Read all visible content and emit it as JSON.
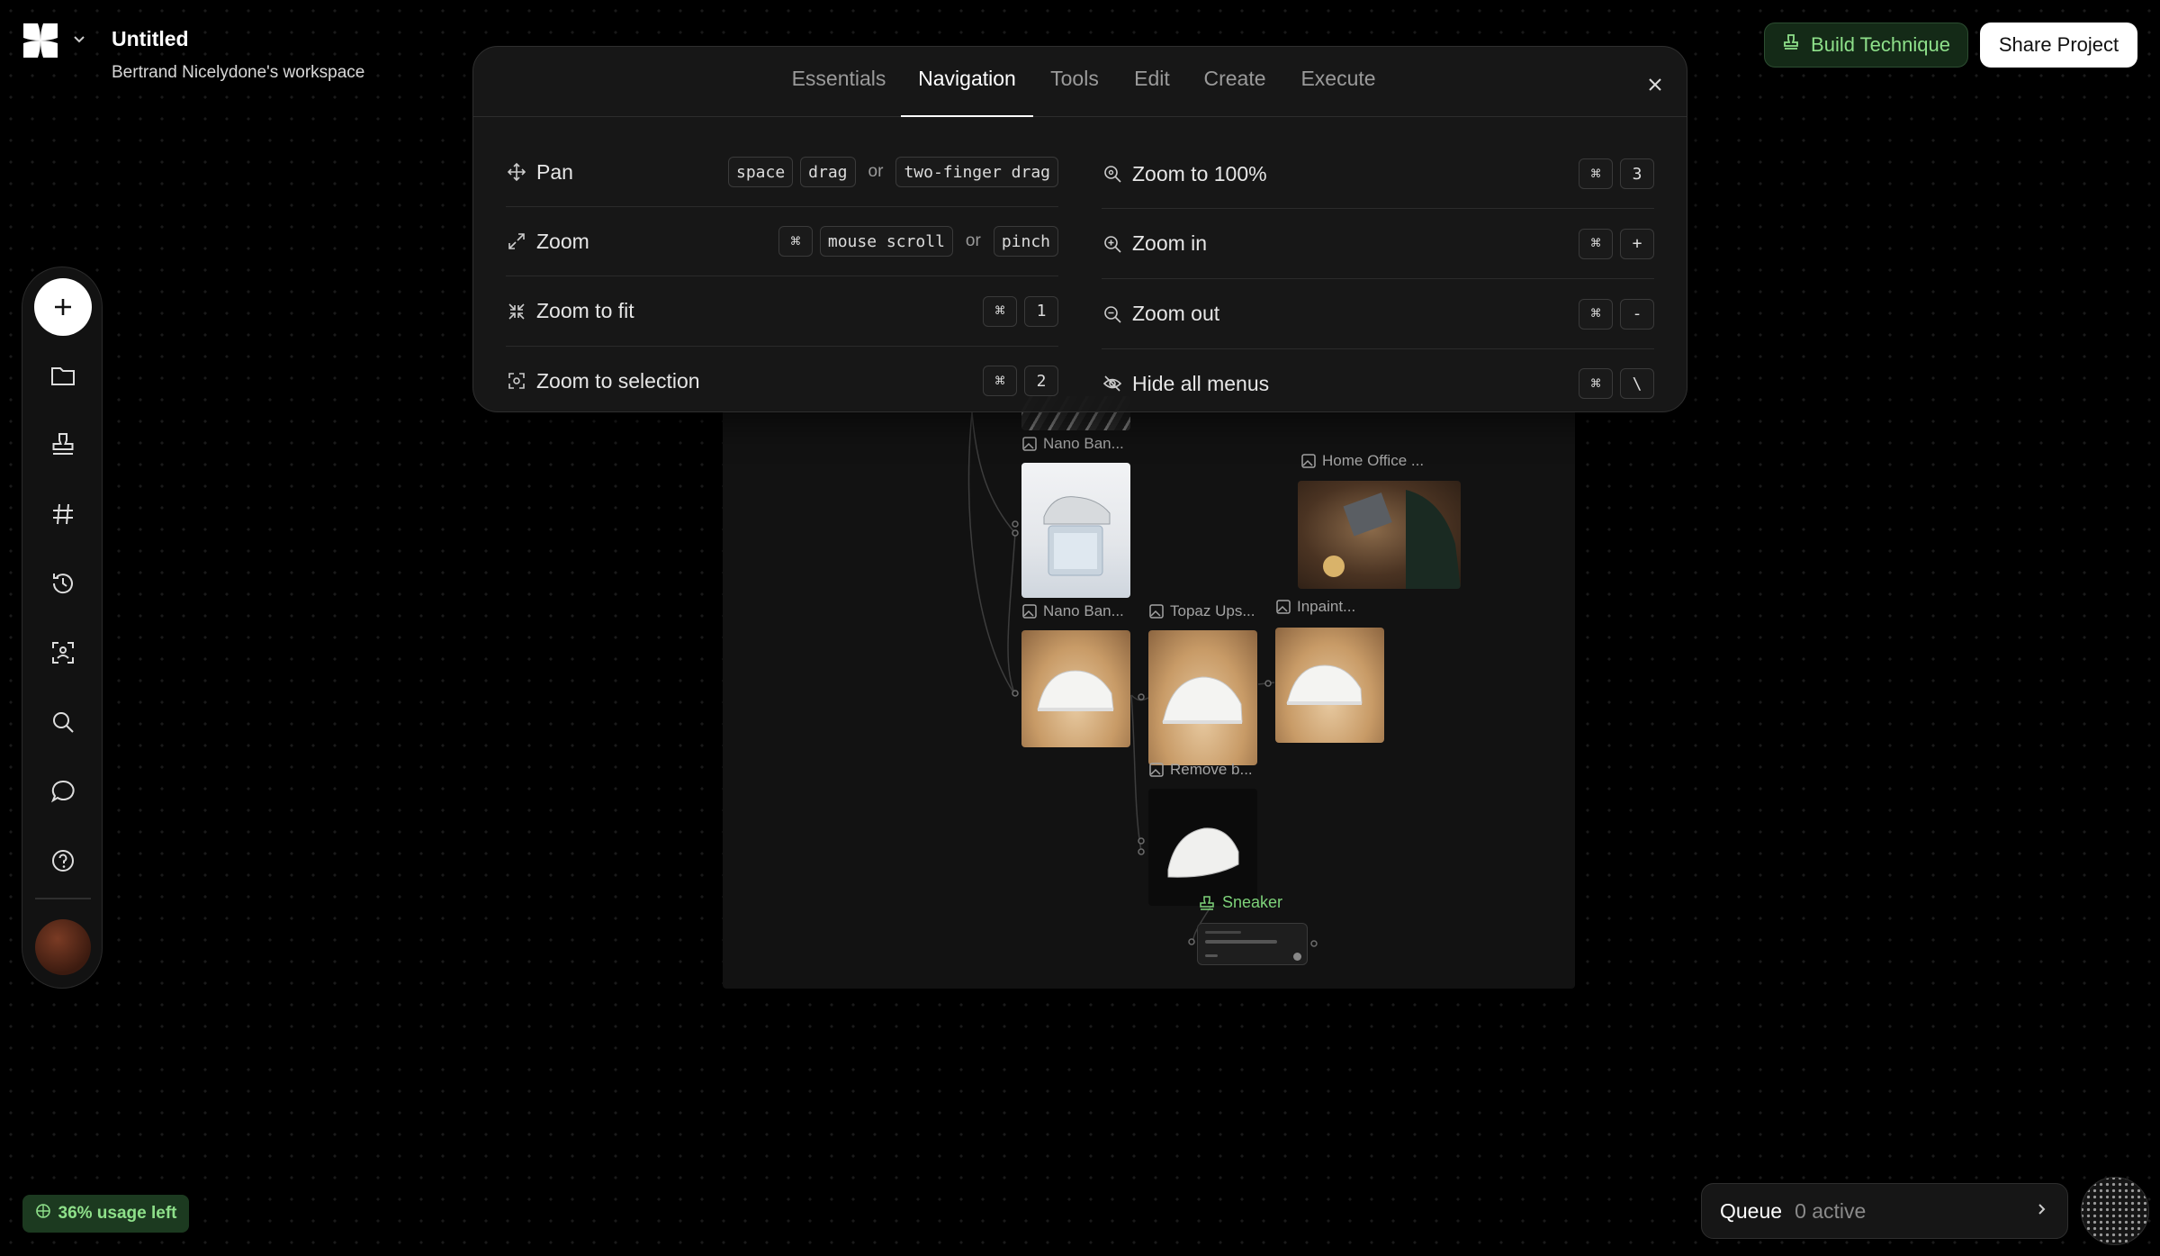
{
  "header": {
    "project_title": "Untitled",
    "workspace": "Bertrand Nicelydone's workspace",
    "build_button": "Build Technique",
    "share_button": "Share Project"
  },
  "toolbar": {
    "icons": [
      "plus-icon",
      "folder-icon",
      "stamp-icon",
      "hash-icon",
      "history-icon",
      "focus-icon",
      "search-icon",
      "chat-icon",
      "help-icon"
    ]
  },
  "panel": {
    "tabs": [
      "Essentials",
      "Navigation",
      "Tools",
      "Edit",
      "Create",
      "Execute"
    ],
    "active_tab": "Navigation",
    "left_rows": [
      {
        "label": "Pan",
        "keys": [
          "space",
          "drag"
        ],
        "or": "or",
        "alt_keys": [
          "two-finger drag"
        ]
      },
      {
        "label": "Zoom",
        "keys": [
          "⌘",
          "mouse scroll"
        ],
        "or": "or",
        "alt_keys": [
          "pinch"
        ]
      },
      {
        "label": "Zoom to fit",
        "keys": [
          "⌘",
          "1"
        ]
      },
      {
        "label": "Zoom to selection",
        "keys": [
          "⌘",
          "2"
        ]
      }
    ],
    "right_rows": [
      {
        "label": "Zoom to 100%",
        "keys": [
          "⌘",
          "3"
        ]
      },
      {
        "label": "Zoom in",
        "keys": [
          "⌘",
          "+"
        ]
      },
      {
        "label": "Zoom out",
        "keys": [
          "⌘",
          "-"
        ]
      },
      {
        "label": "Hide all menus",
        "keys": [
          "⌘",
          "\\"
        ]
      }
    ]
  },
  "canvas": {
    "nodes": {
      "nano1": "Nano Ban...",
      "nano2": "Nano Ban...",
      "home_office": "Home Office ...",
      "topaz": "Topaz Ups...",
      "inpaint": "Inpaint...",
      "remove_bg": "Remove b...",
      "sneaker": "Sneaker"
    }
  },
  "footer": {
    "usage": "36% usage left",
    "queue_label": "Queue",
    "queue_status": "0 active"
  },
  "colors": {
    "accent_green": "#8ee08a",
    "panel_bg": "#181818"
  }
}
